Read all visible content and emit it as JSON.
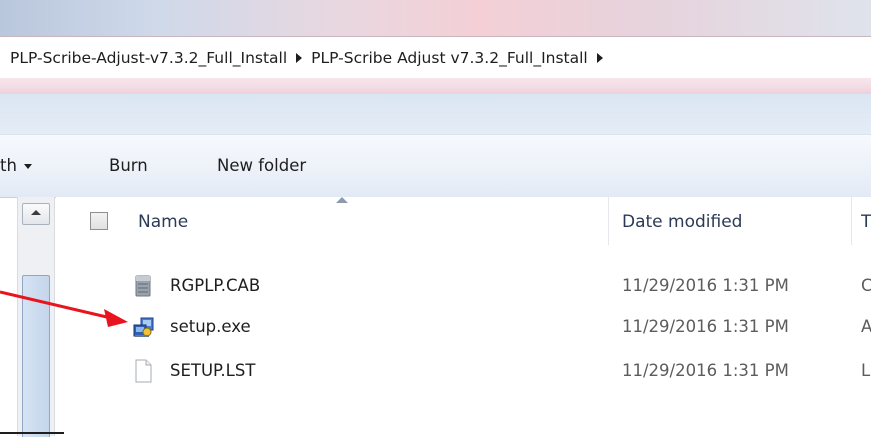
{
  "address_bar": {
    "crumbs": [
      "PLP-Scribe-Adjust-v7.3.2_Full_Install",
      "PLP-Scribe Adjust v7.3.2_Full_Install"
    ]
  },
  "toolbar": {
    "share_with_label": "th",
    "burn_label": "Burn",
    "new_folder_label": "New folder"
  },
  "columns": {
    "name": "Name",
    "date_modified": "Date modified",
    "type": "T"
  },
  "files": [
    {
      "name": "RGPLP.CAB",
      "date": "11/29/2016 1:31 PM",
      "type_initial": "C",
      "icon": "cab-file-icon"
    },
    {
      "name": "setup.exe",
      "date": "11/29/2016 1:31 PM",
      "type_initial": "A",
      "icon": "setup-exe-icon"
    },
    {
      "name": "SETUP.LST",
      "date": "11/29/2016 1:31 PM",
      "type_initial": "L",
      "icon": "blank-file-icon"
    }
  ],
  "annotation": {
    "color": "#e8141e"
  }
}
